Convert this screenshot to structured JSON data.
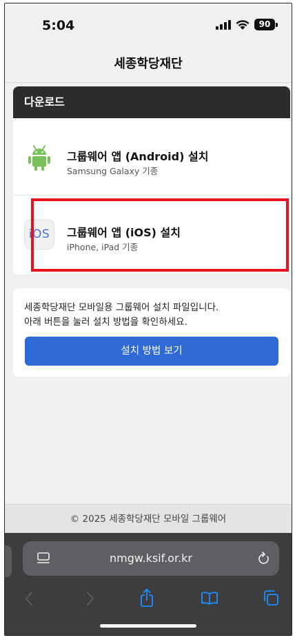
{
  "status_bar": {
    "time": "5:04",
    "battery": "90"
  },
  "header": {
    "title": "세종학당재단"
  },
  "download": {
    "heading": "다운로드",
    "apps": [
      {
        "title": "그룹웨어 앱 (Android) 설치",
        "subtitle": "Samsung Galaxy 기종",
        "icon": "android-icon"
      },
      {
        "title": "그룹웨어 앱 (iOS) 설치",
        "subtitle": "iPhone, iPad 기종",
        "icon": "ios-icon",
        "icon_text": "iOS"
      }
    ]
  },
  "info": {
    "line1": "세종학당재단 모바일용 그룹웨어 설치 파일입니다.",
    "line2": "아래 버튼을 눌러 설치 방법을 확인하세요.",
    "button_label": "설치 방법 보기"
  },
  "footer": {
    "text": "© 2025 세종학당재단 모바일 그룹웨어"
  },
  "browser": {
    "url": "nmgw.ksif.or.kr"
  },
  "colors": {
    "accent_button": "#2f6ad6",
    "highlight_border": "#e3141c",
    "android_green": "#78c257",
    "card_header": "#2c2c2e"
  }
}
